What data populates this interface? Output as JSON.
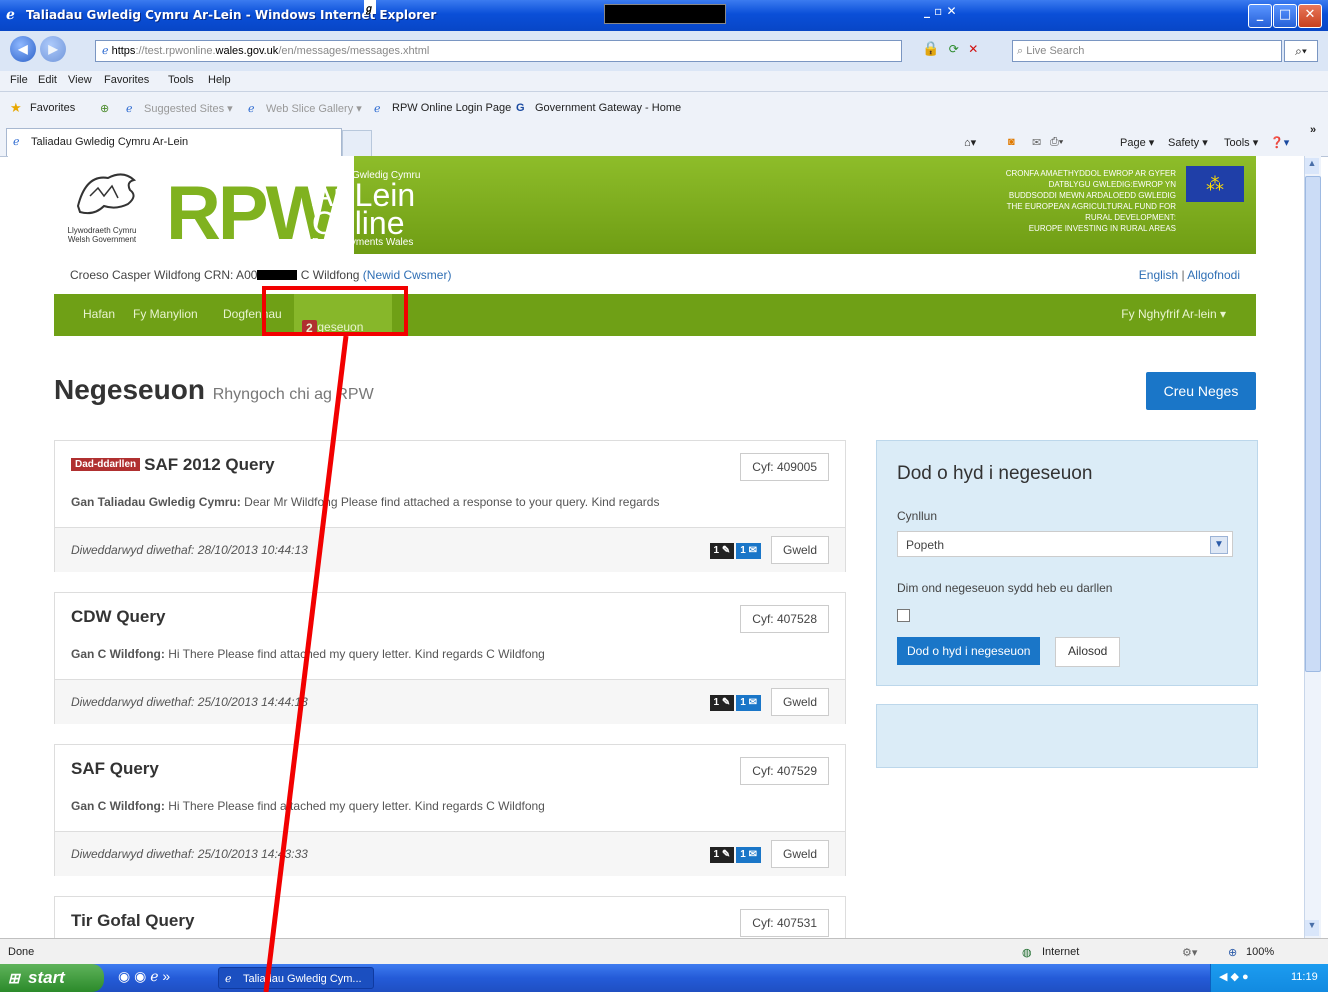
{
  "window": {
    "title": "Taliadau Gwledig Cymru Ar-Lein - Windows Internet Explorer",
    "min": "_",
    "max": "□",
    "close": "✕"
  },
  "address": {
    "https": "https",
    "url_rest_1": "://test.rpwonline.",
    "url_domain": "wales.gov.uk",
    "url_rest_2": "/en/messages/messages.xhtml",
    "search_placeholder": "Live Search"
  },
  "menu": [
    "File",
    "Edit",
    "View",
    "Favorites",
    "Tools",
    "Help"
  ],
  "favorites": {
    "label": "Favorites",
    "items": [
      "Suggested Sites ▾",
      "Web Slice Gallery ▾",
      "RPW Online Login Page",
      "Government Gateway - Home"
    ]
  },
  "tab": {
    "label": "Taliadau Gwledig Cymru Ar-Lein"
  },
  "commands": [
    "Page ▾",
    "Safety ▾",
    "Tools ▾"
  ],
  "site": {
    "logo_text": "RPW",
    "gov_line1": "Llywodraeth Cymru",
    "gov_line2": "Welsh Government",
    "arlein_small": "Taliadau Gwledig Cymru",
    "arlein_big1": "Ar-Lein",
    "arlein_big2": "Online",
    "arlein_sub": "Rural Payments Wales",
    "eu_lines": [
      "CRONFA AMAETHYDDOL EWROP AR GYFER",
      "DATBLYGU GWLEDIG:EWROP YN",
      "BUDDSODDI MEWN ARDALOEDD GWLEDIG",
      "THE EUROPEAN AGRICULTURAL FUND FOR",
      "RURAL DEVELOPMENT:",
      "EUROPE INVESTING IN RURAL AREAS"
    ]
  },
  "welcome": {
    "prefix": "Croeso Casper Wildfong CRN: A00",
    "suffix": " C Wildfong ",
    "link": "(Newid Cwsmer)"
  },
  "lang": {
    "english": "English",
    "sep": "|",
    "logout": "Allgofnodi"
  },
  "nav": {
    "items": [
      "Hafan",
      "Fy Manylion",
      "Dogfennau",
      "Negeseuon"
    ],
    "badge": "2",
    "right": "Fy Nghyfrif Ar-lein ▾"
  },
  "page": {
    "title": "Negeseuon",
    "subtitle": "Rhyngoch chi ag RPW",
    "new_button": "Creu Neges"
  },
  "messages": [
    {
      "unread": "Dad-ddarllen",
      "title": "SAF 2012 Query",
      "ref": "Cyf: 409005",
      "from": "Gan Taliadau Gwledig Cymru:",
      "body": " Dear Mr Wildfong Please find attached a response to your query. Kind regards",
      "date": "Diweddarwyd diwethaf: 28/10/2013 10:44:13",
      "attach": "1",
      "mail": "1",
      "view": "Gweld"
    },
    {
      "unread": "",
      "title": "CDW Query",
      "ref": "Cyf: 407528",
      "from": "Gan C Wildfong:",
      "body": " Hi There Please find attached my query letter. Kind regards C Wildfong",
      "date": "Diweddarwyd diwethaf: 25/10/2013 14:44:13",
      "attach": "1",
      "mail": "1",
      "view": "Gweld"
    },
    {
      "unread": "",
      "title": "SAF Query",
      "ref": "Cyf: 407529",
      "from": "Gan C Wildfong:",
      "body": " Hi There Please find attached my query letter. Kind regards C Wildfong",
      "date": "Diweddarwyd diwethaf: 25/10/2013 14:43:33",
      "attach": "1",
      "mail": "1",
      "view": "Gweld"
    },
    {
      "unread": "",
      "title": "Tir Gofal Query",
      "ref": "Cyf: 407531",
      "from": "",
      "body": "",
      "date": "",
      "attach": "",
      "mail": "",
      "view": ""
    }
  ],
  "filter": {
    "title": "Dod o hyd i negeseuon",
    "scheme_label": "Cynllun",
    "scheme_value": "Popeth",
    "unread_label": "Dim ond negeseuon sydd heb eu darllen",
    "search_button": "Dod o hyd i negeseuon",
    "reset_button": "Ailosod"
  },
  "status": {
    "left": "Done",
    "zone": "Internet",
    "zoom": "100%"
  },
  "taskbar": {
    "start": "start",
    "item": "Taliadau Gwledig Cym...",
    "clock": "11:19"
  },
  "colors": {
    "green": "#6fa016",
    "blue": "#1a76c8",
    "highlight": "#f20000"
  }
}
